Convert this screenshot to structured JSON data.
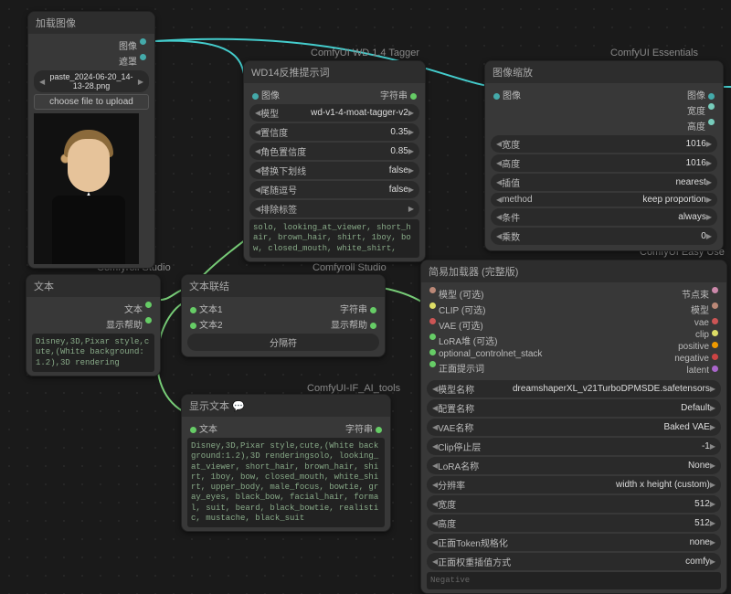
{
  "categories": {
    "wd": "ComfyUI WD 1.4 Tagger",
    "essentials": "ComfyUI Essentials",
    "comfyroll1": "Comfyroll Studio",
    "comfyroll2": "Comfyroll Studio",
    "iftools": "ComfyUI-IF_AI_tools",
    "easyuse": "ComfyUI Easy Use"
  },
  "load_image": {
    "title": "加载图像",
    "out_image": "图像",
    "out_mask": "遮罩",
    "filename": "paste_2024-06-20_14-13-28.png",
    "choose": "choose file to upload"
  },
  "wd14": {
    "title": "WD14反推提示词",
    "in_image": "图像",
    "out_string": "字符串",
    "params": [
      {
        "label": "模型",
        "value": "wd-v1-4-moat-tagger-v2"
      },
      {
        "label": "置信度",
        "value": "0.35"
      },
      {
        "label": "角色置信度",
        "value": "0.85"
      },
      {
        "label": "替换下划线",
        "value": "false"
      },
      {
        "label": "尾随逗号",
        "value": "false"
      },
      {
        "label": "排除标签",
        "value": ""
      }
    ],
    "output": "solo, looking_at_viewer, short_hair, brown_hair, shirt, 1boy, bow, closed_mouth, white_shirt,"
  },
  "scale": {
    "title": "图像缩放",
    "in_image": "图像",
    "out_image": "图像",
    "out_w": "宽度",
    "out_h": "高度",
    "params": [
      {
        "label": "宽度",
        "value": "1016"
      },
      {
        "label": "高度",
        "value": "1016"
      },
      {
        "label": "插值",
        "value": "nearest"
      },
      {
        "label": "method",
        "value": "keep proportion"
      },
      {
        "label": "条件",
        "value": "always"
      },
      {
        "label": "乘数",
        "value": "0"
      }
    ]
  },
  "text": {
    "title": "文本",
    "out_text": "文本",
    "out_help": "显示帮助",
    "value": "Disney,3D,Pixar style,cute,(White background:1.2),3D rendering"
  },
  "concat": {
    "title": "文本联结",
    "in_text1": "文本1",
    "in_text2": "文本2",
    "out_string": "字符串",
    "out_help": "显示帮助",
    "sep_label": "分隔符",
    "sep_value": ""
  },
  "show": {
    "title": "显示文本 💬",
    "in_text": "文本",
    "out_string": "字符串",
    "value": "Disney,3D,Pixar style,cute,(White background:1.2),3D renderingsolo, looking_at_viewer, short_hair, brown_hair, shirt, 1boy, bow, closed_mouth, white_shirt, upper_body, male_focus, bowtie, gray_eyes, black_bow, facial_hair, formal, suit, beard, black_bowtie, realistic, mustache, black_suit"
  },
  "loader": {
    "title": "简易加载器 (完整版)",
    "in": [
      {
        "label": "模型 (可选)",
        "cls": "c-mdl"
      },
      {
        "label": "CLIP (可选)",
        "cls": "c-clip"
      },
      {
        "label": "VAE (可选)",
        "cls": "c-vae"
      },
      {
        "label": "LoRA堆 (可选)",
        "cls": "c-str"
      },
      {
        "label": "optional_controlnet_stack",
        "cls": "c-str"
      },
      {
        "label": "正面提示词",
        "cls": "c-str"
      }
    ],
    "out": [
      {
        "label": "节点束",
        "cls": "c-pipe"
      },
      {
        "label": "模型",
        "cls": "c-mdl"
      },
      {
        "label": "vae",
        "cls": "c-vae"
      },
      {
        "label": "clip",
        "cls": "c-clip"
      },
      {
        "label": "positive",
        "cls": "c-pos"
      },
      {
        "label": "negative",
        "cls": "c-neg"
      },
      {
        "label": "latent",
        "cls": "c-lat"
      }
    ],
    "params": [
      {
        "label": "模型名称",
        "value": "dreamshaperXL_v21TurboDPMSDE.safetensors"
      },
      {
        "label": "配置名称",
        "value": "Default"
      },
      {
        "label": "VAE名称",
        "value": "Baked VAE"
      },
      {
        "label": "Clip停止层",
        "value": "-1"
      },
      {
        "label": "LoRA名称",
        "value": "None"
      },
      {
        "label": "分辨率",
        "value": "width x height (custom)"
      },
      {
        "label": "宽度",
        "value": "512"
      },
      {
        "label": "高度",
        "value": "512"
      },
      {
        "label": "正面Token规格化",
        "value": "none"
      },
      {
        "label": "正面权重插值方式",
        "value": "comfy"
      }
    ],
    "negative_label": "Negative"
  }
}
